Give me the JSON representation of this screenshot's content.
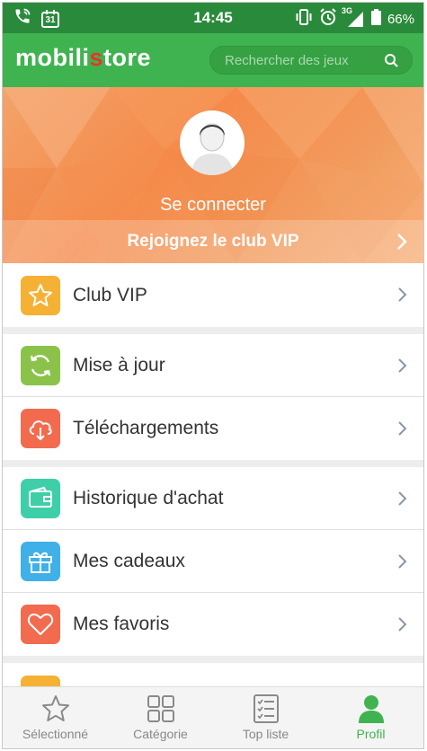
{
  "status": {
    "time": "14:45",
    "network": "3G",
    "battery": "66%",
    "calendar_day": "31"
  },
  "header": {
    "logo_part1": "mobili",
    "logo_part2": "s",
    "logo_part3": "tore",
    "search_placeholder": "Rechercher des jeux"
  },
  "profile": {
    "login_label": "Se connecter",
    "vip_banner_label": "Rejoignez le club VIP"
  },
  "menu": [
    {
      "label": "Club VIP",
      "icon": "star-icon",
      "color": "#f5b133"
    },
    {
      "label": "Mise à jour",
      "icon": "refresh-icon",
      "color": "#8bc34a"
    },
    {
      "label": "Téléchargements",
      "icon": "cloud-download-icon",
      "color": "#f26b4f"
    },
    {
      "label": "Historique d'achat",
      "icon": "wallet-icon",
      "color": "#3ecfa9"
    },
    {
      "label": "Mes cadeaux",
      "icon": "gift-icon",
      "color": "#3fb1e8"
    },
    {
      "label": "Mes favoris",
      "icon": "heart-icon",
      "color": "#f26b4f"
    }
  ],
  "nav": {
    "items": [
      {
        "label": "Sélectionné",
        "icon": "star-outline-icon"
      },
      {
        "label": "Catégorie",
        "icon": "grid-icon"
      },
      {
        "label": "Top liste",
        "icon": "list-icon"
      },
      {
        "label": "Profil",
        "icon": "person-icon"
      }
    ],
    "active": "Profil"
  },
  "colors": {
    "accent": "#3fb34f",
    "status_bar": "#2a8a3b",
    "banner": "#f58a4a"
  }
}
